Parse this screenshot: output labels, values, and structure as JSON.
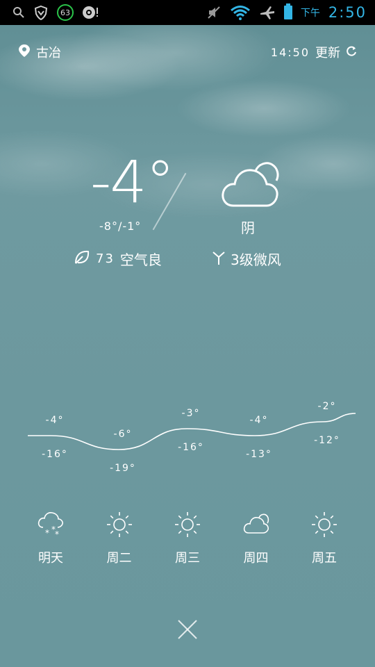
{
  "status_bar": {
    "icons_left": [
      "search-icon",
      "shield-icon",
      "badge-63",
      "camera-icon"
    ],
    "badge_value": "63",
    "icons_right": [
      "mute-icon",
      "wifi-icon",
      "airplane-icon",
      "battery-icon"
    ],
    "time_label": "下午",
    "time_value": "2:50",
    "accent_color": "#33b5e5"
  },
  "header": {
    "location": "古冶",
    "updated_time": "14:50",
    "refresh_label": "更新"
  },
  "current": {
    "temperature": "-4°",
    "range": "-8°/-1°",
    "condition": "阴",
    "condition_icon": "cloud-icon",
    "air_quality_value": "73",
    "air_quality_label": "空气良",
    "wind": "3级微风"
  },
  "forecast": [
    {
      "day": "明天",
      "high": "-4°",
      "low": "-16°",
      "icon": "snow-cloud-icon"
    },
    {
      "day": "周二",
      "high": "-6°",
      "low": "-19°",
      "icon": "sun-icon"
    },
    {
      "day": "周三",
      "high": "-3°",
      "low": "-16°",
      "icon": "sun-icon"
    },
    {
      "day": "周四",
      "high": "-4°",
      "low": "-13°",
      "icon": "cloud-icon"
    },
    {
      "day": "周五",
      "high": "-2°",
      "low": "-12°",
      "icon": "sun-icon"
    }
  ],
  "chart_data": {
    "type": "line",
    "categories": [
      "明天",
      "周二",
      "周三",
      "周四",
      "周五"
    ],
    "series": [
      {
        "values": [
          -4,
          -6,
          -3,
          -4,
          -2
        ]
      },
      {
        "values": [
          -16,
          -19,
          -16,
          -13,
          -12
        ]
      }
    ]
  },
  "close_icon": "close-icon"
}
